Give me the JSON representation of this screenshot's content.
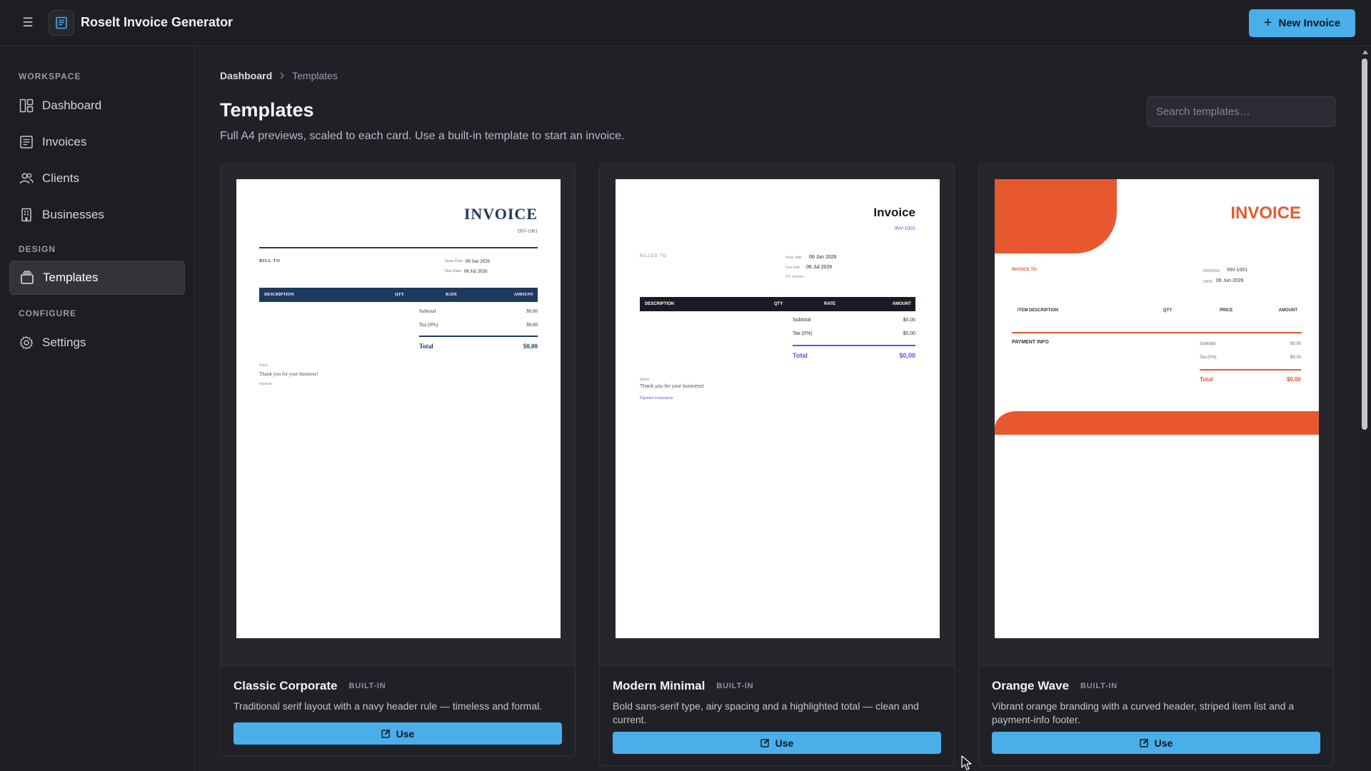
{
  "app": {
    "title": "Roselt Invoice Generator",
    "new_invoice_label": "New Invoice",
    "accent": "#4aaee8"
  },
  "sidebar": {
    "sections": [
      {
        "label": "WORKSPACE"
      },
      {
        "label": "DESIGN"
      },
      {
        "label": "CONFIGURE"
      }
    ],
    "items": [
      {
        "label": "Dashboard",
        "icon": "dashboard-icon"
      },
      {
        "label": "Invoices",
        "icon": "invoice-icon"
      },
      {
        "label": "Clients",
        "icon": "users-icon"
      },
      {
        "label": "Businesses",
        "icon": "building-icon"
      },
      {
        "label": "Templates",
        "icon": "templates-icon",
        "active": true
      },
      {
        "label": "Settings",
        "icon": "gear-icon"
      }
    ]
  },
  "breadcrumb": {
    "home": "Dashboard",
    "current": "Templates"
  },
  "page": {
    "title": "Templates",
    "subtitle": "Full A4 previews, scaled to each card. Use a built-in template to start an invoice.",
    "search_placeholder": "Search templates…"
  },
  "templates": [
    {
      "name": "Classic Corporate",
      "badge": "BUILT-IN",
      "description": "Traditional serif layout with a navy header rule — timeless and formal.",
      "button": "Use",
      "color": "#1f3a5f",
      "preview": {
        "heading": "INVOICE",
        "number": "INV-1001",
        "bill_to": "BILL TO",
        "issue_label": "Issue Date",
        "issue_value": "06 Jun 2026",
        "due_label": "Due Date",
        "due_value": "06 Jul 2026",
        "cols": [
          "DESCRIPTION",
          "QTY",
          "RATE",
          "AMOUNT"
        ],
        "subtotal_label": "Subtotal",
        "subtotal_value": "$0,00",
        "tax_label": "Tax (0%)",
        "tax_value": "$0,00",
        "total_label": "Total",
        "total_value": "$0,00",
        "notes_label": "Notes",
        "notes_text": "Thank you for your business!",
        "payment_label": "Payment"
      }
    },
    {
      "name": "Modern Minimal",
      "badge": "BUILT-IN",
      "description": "Bold sans-serif type, airy spacing and a highlighted total — clean and current.",
      "button": "Use",
      "color": "#1a1b23",
      "preview": {
        "heading": "Invoice",
        "number": "INV-1001",
        "bill_to": "BILLED TO",
        "issue_label": "Issue date",
        "issue_value": "06 Jun 2026",
        "due_label": "Due date",
        "due_value": "06 Jul 2026",
        "po_label": "PO number",
        "cols": [
          "DESCRIPTION",
          "QTY",
          "RATE",
          "AMOUNT"
        ],
        "subtotal_label": "Subtotal",
        "subtotal_value": "$0,00",
        "tax_label": "Tax (0%)",
        "tax_value": "$0,00",
        "total_label": "Total",
        "total_value": "$0,00",
        "notes_label": "Notes",
        "notes_text": "Thank you for your business!",
        "payment_label": "Payment instructions"
      }
    },
    {
      "name": "Orange Wave",
      "badge": "BUILT-IN",
      "description": "Vibrant orange branding with a curved header, striped item list and a payment-info footer.",
      "button": "Use",
      "color": "#e8582f",
      "preview": {
        "heading": "INVOICE",
        "invoice_to": "INVOICE TO:",
        "number_label": "INVOICE#",
        "number_value": "INV-1001",
        "date_label": "DATE",
        "date_value": "06 Jun 2026",
        "cols": [
          "ITEM DESCRIPTION",
          "QTY",
          "PRICE",
          "AMOUNT"
        ],
        "payment_info": "PAYMENT INFO",
        "subtotal_label": "Subtotal",
        "subtotal_value": "$0,00",
        "tax_label": "Tax (0%)",
        "tax_value": "$0,00",
        "total_label": "Total",
        "total_value": "$0,00"
      }
    }
  ]
}
